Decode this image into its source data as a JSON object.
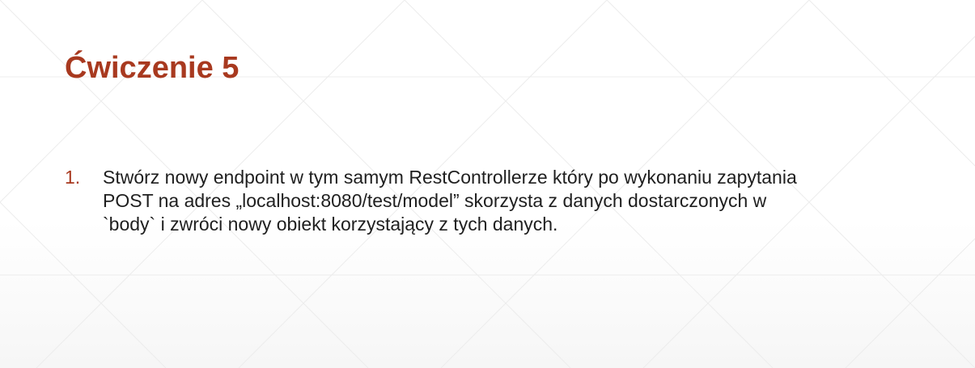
{
  "slide": {
    "title": "Ćwiczenie 5",
    "items": [
      {
        "number": "1.",
        "lines": [
          "Stwórz nowy endpoint w tym samym RestControllerze który po wykonaniu zapytania",
          "POST na adres „localhost:8080/test/model” skorzysta z danych dostarczonych w",
          "`body` i zwróci nowy obiekt korzystający z tych danych."
        ]
      }
    ]
  },
  "colors": {
    "accent": "#a8391f",
    "text": "#1f1f1f",
    "pattern": "#ededed"
  }
}
